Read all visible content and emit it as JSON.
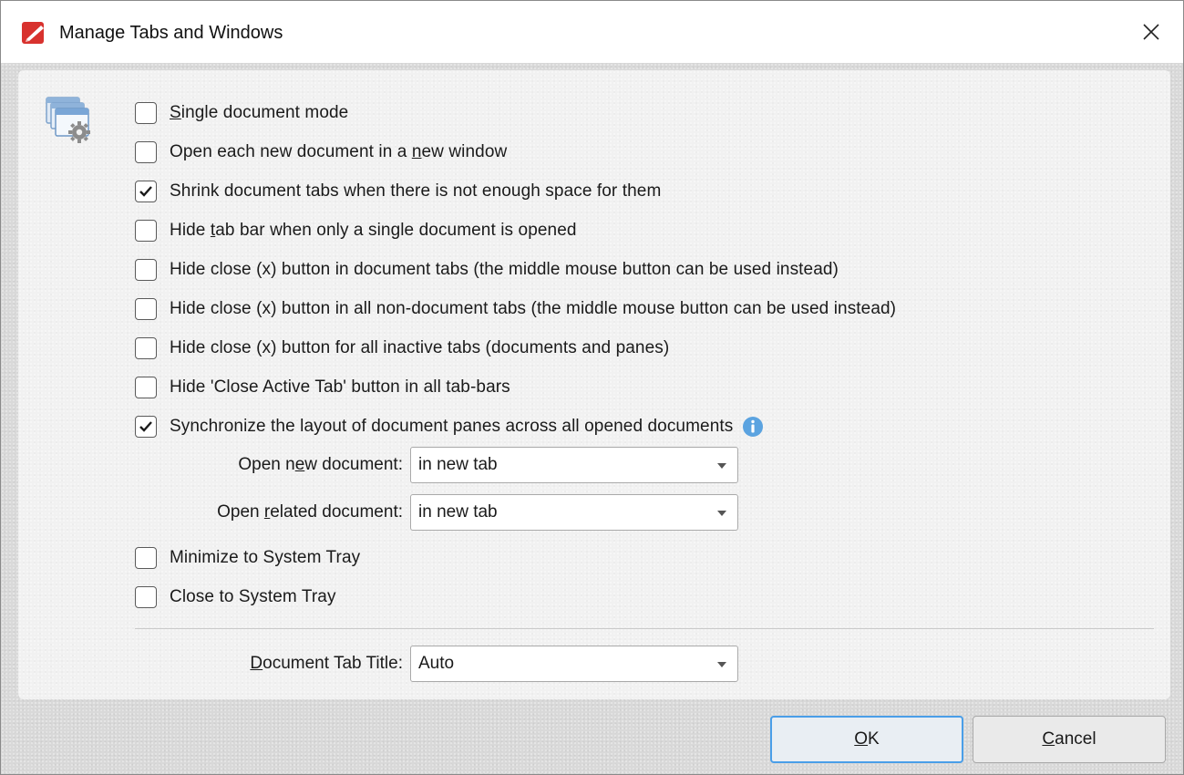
{
  "window": {
    "title": "Manage Tabs and Windows",
    "accent": "#4a9ee8"
  },
  "options": [
    {
      "pre": "",
      "key": "S",
      "post": "ingle document mode",
      "checked": false
    },
    {
      "pre": "Open each new document in a ",
      "key": "n",
      "post": "ew window",
      "checked": false
    },
    {
      "pre": "Shrink document tabs when there is not enough space for them",
      "key": "",
      "post": "",
      "checked": true
    },
    {
      "pre": "Hide ",
      "key": "t",
      "post": "ab bar when only a single document is opened",
      "checked": false
    },
    {
      "pre": "Hide close (x) button in document tabs (the middle mouse button can be used instead)",
      "key": "",
      "post": "",
      "checked": false
    },
    {
      "pre": "Hide close (x) button in all non-document tabs (the middle mouse button can be used instead)",
      "key": "",
      "post": "",
      "checked": false
    },
    {
      "pre": "Hide close (x) button for all inactive tabs (documents and panes)",
      "key": "",
      "post": "",
      "checked": false
    },
    {
      "pre": "Hide 'Close Active Tab' button in all tab-bars",
      "key": "",
      "post": "",
      "checked": false
    },
    {
      "pre": "Synchronize the layout of document panes across all opened documents",
      "key": "",
      "post": "",
      "checked": true
    },
    {
      "pre": "Minimize to System Tray",
      "key": "",
      "post": "",
      "checked": false
    },
    {
      "pre": "Close to System Tray",
      "key": "",
      "post": "",
      "checked": false
    }
  ],
  "open_new": {
    "pre": "Open n",
    "key": "e",
    "post": "w document:",
    "value": "in new tab"
  },
  "open_related": {
    "pre": "Open ",
    "key": "r",
    "post": "elated document:",
    "value": "in new tab"
  },
  "tab_title": {
    "pre": "",
    "key": "D",
    "post": "ocument Tab Title:",
    "value": "Auto"
  },
  "buttons": {
    "ok": {
      "key": "O",
      "post": "K"
    },
    "cancel": {
      "key": "C",
      "post": "ancel"
    }
  },
  "icons": [
    "app-logo-icon",
    "close-icon",
    "tabs-settings-icon",
    "checkmark-icon",
    "info-icon",
    "chevron-down-icon"
  ]
}
